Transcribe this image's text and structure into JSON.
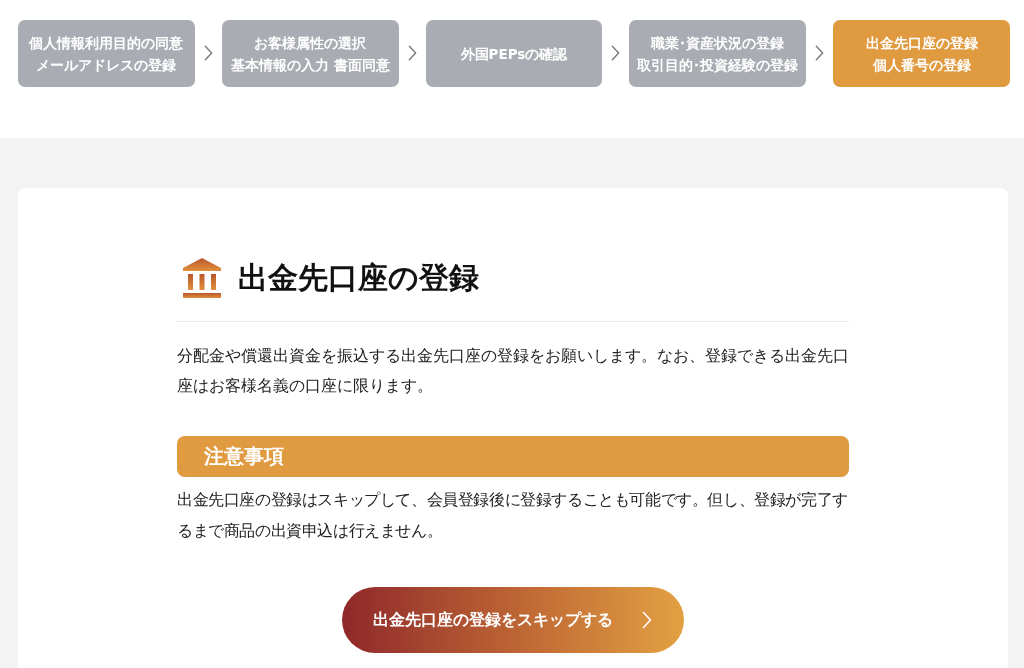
{
  "steps": [
    {
      "lines": [
        "個人情報利用目的の同意",
        "メールアドレスの登録"
      ],
      "selected": false
    },
    {
      "lines": [
        "お客様属性の選択",
        "基本情報の入力 書面同意"
      ],
      "selected": false
    },
    {
      "lines": [
        "外国PEPsの確認"
      ],
      "selected": false
    },
    {
      "lines": [
        "職業･資産状況の登録",
        "取引目的･投資経験の登録"
      ],
      "selected": false
    },
    {
      "lines": [
        "出金先口座の登録",
        "個人番号の登録"
      ],
      "selected": true
    }
  ],
  "section": {
    "title": "出金先口座の登録",
    "description": "分配金や償還出資金を振込する出金先口座の登録をお願いします。なお、登録できる出金先口座はお客様名義の口座に限ります。",
    "notice": {
      "heading": "注意事項",
      "text": "出金先口座の登録はスキップして、会員登録後に登録することも可能です。但し、登録が完了するまで商品の出資申込は行えません。"
    },
    "skip_button": {
      "label": "出金先口座の登録をスキップする"
    }
  }
}
